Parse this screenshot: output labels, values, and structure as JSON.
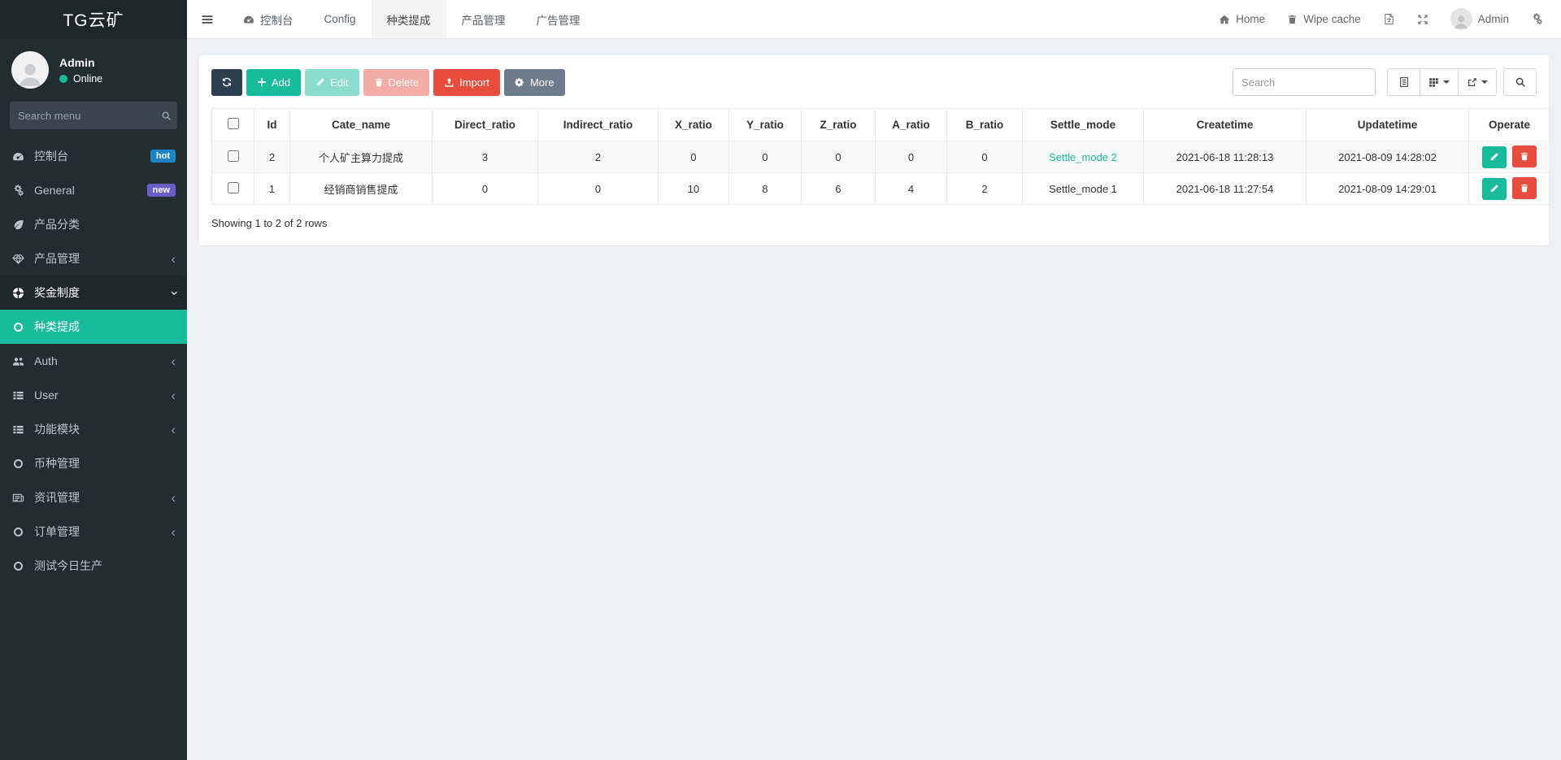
{
  "brand": {
    "title": "TG云矿"
  },
  "user_panel": {
    "name": "Admin",
    "status": "Online"
  },
  "sidebar": {
    "search_placeholder": "Search menu",
    "items": [
      {
        "label": "控制台",
        "icon": "tachometer-icon",
        "badge": "hot"
      },
      {
        "label": "General",
        "icon": "gears-icon",
        "badge": "new"
      },
      {
        "label": "产品分类",
        "icon": "leaf-icon"
      },
      {
        "label": "产品管理",
        "icon": "gem-icon",
        "chevron": "left"
      },
      {
        "label": "奖金制度",
        "icon": "ring-icon",
        "chevron": "down",
        "state": "open"
      },
      {
        "label": "种类提成",
        "icon": "circle-icon",
        "state": "active"
      },
      {
        "label": "Auth",
        "icon": "users-icon",
        "chevron": "left"
      },
      {
        "label": "User",
        "icon": "list-icon",
        "chevron": "left"
      },
      {
        "label": "功能模块",
        "icon": "list-icon",
        "chevron": "left"
      },
      {
        "label": "币种管理",
        "icon": "circle-icon"
      },
      {
        "label": "资讯管理",
        "icon": "newspaper-icon",
        "chevron": "left"
      },
      {
        "label": "订单管理",
        "icon": "circle-icon",
        "chevron": "left"
      },
      {
        "label": "测试今日生产",
        "icon": "circle-icon"
      }
    ]
  },
  "topbar": {
    "tabs": [
      {
        "label": "控制台",
        "icon": "tachometer-icon"
      },
      {
        "label": "Config"
      },
      {
        "label": "种类提成",
        "active": true
      },
      {
        "label": "产品管理"
      },
      {
        "label": "广告管理"
      }
    ],
    "right": {
      "home": "Home",
      "wipe_cache": "Wipe cache",
      "admin": "Admin"
    }
  },
  "toolbar": {
    "refresh_label": "",
    "add_label": "Add",
    "edit_label": "Edit",
    "delete_label": "Delete",
    "import_label": "Import",
    "more_label": "More",
    "search_placeholder": "Search"
  },
  "table": {
    "columns": [
      "Id",
      "Cate_name",
      "Direct_ratio",
      "Indirect_ratio",
      "X_ratio",
      "Y_ratio",
      "Z_ratio",
      "A_ratio",
      "B_ratio",
      "Settle_mode",
      "Createtime",
      "Updatetime",
      "Operate"
    ],
    "rows": [
      {
        "cells": [
          "2",
          "个人矿主算力提成",
          "3",
          "2",
          "0",
          "0",
          "0",
          "0",
          "0",
          "Settle_mode 2",
          "2021-06-18 11:28:13",
          "2021-08-09 14:28:02"
        ]
      },
      {
        "cells": [
          "1",
          "经销商销售提成",
          "0",
          "0",
          "10",
          "8",
          "6",
          "4",
          "2",
          "Settle_mode 1",
          "2021-06-18 11:27:54",
          "2021-08-09 14:29:01"
        ]
      }
    ],
    "footer": "Showing 1 to 2 of 2 rows"
  },
  "colors": {
    "accent": "#18bc9c",
    "primary": "#2c3e50",
    "danger": "#e74c3c",
    "badge_hot": "#1c84c6",
    "badge_new": "#6a5fc9",
    "sidebar_bg": "#222d32"
  }
}
